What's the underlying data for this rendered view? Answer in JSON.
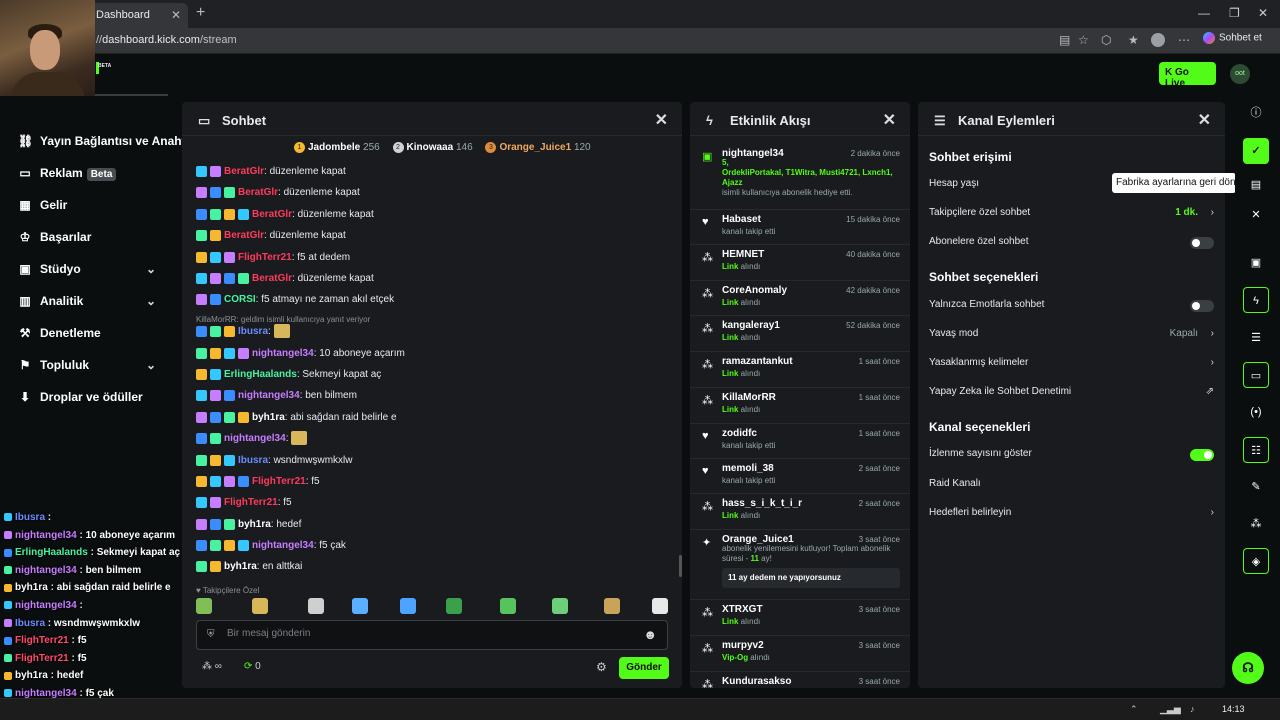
{
  "browser": {
    "tab_title": "Dashboard",
    "url_prefix": "//",
    "url_host": "dashboard.kick.com",
    "url_path": "/stream",
    "copilot_label": "Sohbet et"
  },
  "header": {
    "go_live": "Go Live",
    "beta": "BETA",
    "avatar": "oot"
  },
  "sidebar": {
    "items": [
      {
        "label": "Yayın Bağlantısı ve Anahtarı",
        "icon": "link-icon"
      },
      {
        "label": "Reklam",
        "icon": "ad-icon",
        "badge": "Beta"
      },
      {
        "label": "Gelir",
        "icon": "revenue-icon"
      },
      {
        "label": "Başarılar",
        "icon": "trophy-icon"
      },
      {
        "label": "Stüdyo",
        "icon": "studio-icon",
        "expand": true
      },
      {
        "label": "Analitik",
        "icon": "analytics-icon",
        "expand": true
      },
      {
        "label": "Denetleme",
        "icon": "moderation-icon"
      },
      {
        "label": "Topluluk",
        "icon": "community-icon",
        "expand": true
      },
      {
        "label": "Droplar ve ödüller",
        "icon": "drops-icon"
      }
    ]
  },
  "overlay_chat": [
    {
      "user": "Ibusra",
      "text": "",
      "color": "#6b8cff"
    },
    {
      "user": "nightangel34",
      "text": "10 aboneye açarım",
      "color": "#c77dff"
    },
    {
      "user": "ErlingHaalands",
      "text": "Sekmeyi kapat aç",
      "color": "#49f2a0"
    },
    {
      "user": "nightangel34",
      "text": "ben bilmem",
      "color": "#c77dff"
    },
    {
      "user": "byh1ra",
      "text": "abi sağdan raid belirle e",
      "color": "#ffffff"
    },
    {
      "user": "nightangel34",
      "text": "",
      "color": "#c77dff"
    },
    {
      "user": "Ibusra",
      "text": "wsndmwşwmkxlw",
      "color": "#6b8cff"
    },
    {
      "user": "FlighTerr21",
      "text": "f5",
      "color": "#ff4a6a"
    },
    {
      "user": "FlighTerr21",
      "text": "f5",
      "color": "#ff4a6a"
    },
    {
      "user": "byh1ra",
      "text": "hedef",
      "color": "#ffffff"
    },
    {
      "user": "nightangel34",
      "text": "f5 çak",
      "color": "#c77dff"
    },
    {
      "user": "byh1ra",
      "text": "en alttkai",
      "color": "#ffffff"
    }
  ],
  "chat": {
    "title": "Sohbet",
    "leaders": [
      {
        "rank": "1",
        "name": "Jadombele",
        "count": "256",
        "color": "#f5b82e"
      },
      {
        "rank": "2",
        "name": "Kinowaaa",
        "count": "146",
        "color": "#cfd3d6"
      },
      {
        "rank": "3",
        "name": "Orange_Juice1",
        "count": "120",
        "color": "#e08a3c"
      }
    ],
    "messages": [
      {
        "user": "BeratGlr",
        "text": "düzenleme kapat",
        "color": "#ff3b5c"
      },
      {
        "user": "BeratGlr",
        "text": "düzenleme kapat",
        "color": "#ff3b5c"
      },
      {
        "user": "BeratGlr",
        "text": "düzenleme kapat",
        "color": "#ff3b5c"
      },
      {
        "user": "BeratGlr",
        "text": "düzenleme kapat",
        "color": "#ff3b5c"
      },
      {
        "user": "FlighTerr21",
        "text": "f5 at dedem",
        "color": "#ff3b5c"
      },
      {
        "user": "BeratGlr",
        "text": "düzenleme kapat",
        "color": "#ff3b5c"
      },
      {
        "user": "CORSI",
        "text": "f5 atmayı ne zaman akıl etçek",
        "color": "#49f2a0"
      },
      {
        "user": "Ibusra",
        "text": "",
        "color": "#6b8cff"
      },
      {
        "user": "nightangel34",
        "text": "10 aboneye açarım",
        "color": "#c77dff"
      },
      {
        "user": "ErlingHaalands",
        "text": "Sekmeyi kapat aç",
        "color": "#49f2a0"
      },
      {
        "user": "nightangel34",
        "text": "ben bilmem",
        "color": "#c77dff"
      },
      {
        "user": "byh1ra",
        "text": "abi sağdan raid belirle e",
        "color": "#ffffff"
      },
      {
        "user": "nightangel34",
        "text": "",
        "color": "#c77dff"
      },
      {
        "user": "Ibusra",
        "text": "wsndmwşwmkxlw",
        "color": "#6b8cff"
      },
      {
        "user": "FlighTerr21",
        "text": "f5",
        "color": "#ff3b5c"
      },
      {
        "user": "FlighTerr21",
        "text": "f5",
        "color": "#ff3b5c"
      },
      {
        "user": "byh1ra",
        "text": "hedef",
        "color": "#ffffff"
      },
      {
        "user": "nightangel34",
        "text": "f5 çak",
        "color": "#c77dff"
      },
      {
        "user": "byh1ra",
        "text": "en alttkai",
        "color": "#ffffff"
      }
    ],
    "reply_note": "KillaMorRR: geldim isimli kullanıcıya yanıt veriyor",
    "followers_label": "Takipçilere Özel",
    "input_placeholder": "Bir mesaj gönderin",
    "points_left": "∞",
    "points_right": "0",
    "send": "Gönder"
  },
  "activity": {
    "title": "Etkinlik Akışı",
    "items": [
      {
        "name": "nightangel34",
        "time": "2 dakika önce",
        "type": "gift",
        "lines": [
          "5,",
          "OrdekliPortakal, T1Witra, Musti4721, Lxnch1, Ajazz"
        ],
        "sub": "isimli kullanıcıya abonelik hediye etti."
      },
      {
        "name": "Habaset",
        "time": "15 dakika önce",
        "type": "follow",
        "sub": "kanalı takip etti"
      },
      {
        "name": "HEMNET",
        "time": "40 dakika önce",
        "type": "link",
        "hl": "Link",
        "sub": " alındı"
      },
      {
        "name": "CoreAnomaly",
        "time": "42 dakika önce",
        "type": "link",
        "hl": "Link",
        "sub": " alındı"
      },
      {
        "name": "kangaleray1",
        "time": "52 dakika önce",
        "type": "link",
        "hl": "Link",
        "sub": " alındı"
      },
      {
        "name": "ramazantankut",
        "time": "1 saat önce",
        "type": "link",
        "hl": "Link",
        "sub": " alındı"
      },
      {
        "name": "KillaMorRR",
        "time": "1 saat önce",
        "type": "link",
        "hl": "Link",
        "sub": " alındı"
      },
      {
        "name": "zodidfc",
        "time": "1 saat önce",
        "type": "follow",
        "sub": "kanalı takip etti"
      },
      {
        "name": "memoli_38",
        "time": "2 saat önce",
        "type": "follow",
        "sub": "kanalı takip etti"
      },
      {
        "name": "hass_s_i_k_t_i_r",
        "time": "2 saat önce",
        "type": "link",
        "hl": "Link",
        "sub": " alındı"
      },
      {
        "name": "Orange_Juice1",
        "time": "3 saat önce",
        "type": "resub",
        "lines": [
          "abonelik yenilemesini kutluyor! Toplam abonelik süresi - ",
          "11",
          " ay!"
        ],
        "note": "11 ay dedem ne yapıyorsunuz"
      },
      {
        "name": "XTRXGT",
        "time": "3 saat önce",
        "type": "link",
        "hl": "Link",
        "sub": " alındı"
      },
      {
        "name": "murpyv2",
        "time": "3 saat önce",
        "type": "link",
        "hl": "Vip-Og",
        "sub": " alındı"
      },
      {
        "name": "Kundurasakso",
        "time": "3 saat önce",
        "type": "link",
        "hl": "",
        "sub": ""
      }
    ]
  },
  "channel": {
    "title": "Kanal Eylemleri",
    "chat_access": "Sohbet erişimi",
    "account_age": "Hesap yaşı",
    "followers_only": "Takipçilere özel sohbet",
    "followers_value": "1 dk.",
    "subs_only": "Abonelere özel sohbet",
    "chat_options": "Sohbet seçenekleri",
    "emotes_only": "Yalnızca Emotlarla sohbet",
    "slow_mode": "Yavaş mod",
    "slow_value": "Kapalı",
    "banned_words": "Yasaklanmış kelimeler",
    "ai_moderation": "Yapay Zeka ile Sohbet Denetimi",
    "channel_options": "Kanal seçenekleri",
    "show_viewers": "İzlenme sayısını göster",
    "raid": "Raid Kanalı",
    "targets": "Hedefleri belirleyin",
    "tooltip": "Fabrika ayarlarına geri dön"
  },
  "taskbar": {
    "clock": "14:13"
  }
}
